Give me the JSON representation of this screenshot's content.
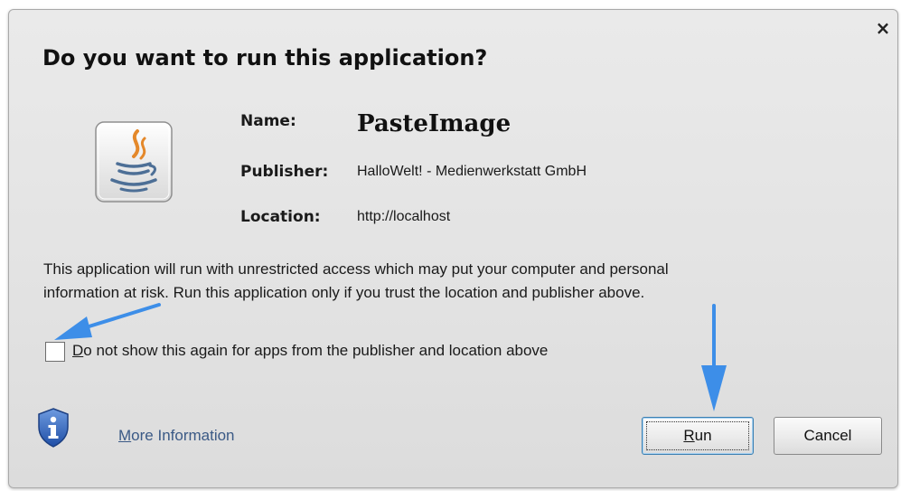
{
  "dialog": {
    "title": "Do you want to run this application?",
    "close_glyph": "×"
  },
  "app_info": {
    "name_label": "Name:",
    "name_value": "PasteImage",
    "publisher_label": "Publisher:",
    "publisher_value": "HalloWelt! - Medienwerkstatt GmbH",
    "location_label": "Location:",
    "location_value": "http://localhost"
  },
  "warning": {
    "line1": "This application will run with unrestricted access which may put your computer and personal",
    "line2": "information at risk. Run this application only if you trust the location and publisher above."
  },
  "checkbox": {
    "label_mnemonic": "D",
    "label_rest": "o not show this again for apps from the publisher and location above",
    "checked": false
  },
  "footer": {
    "more_info_mnemonic": "M",
    "more_info_rest": "ore Information",
    "run_mnemonic": "R",
    "run_rest": "un",
    "cancel_label": "Cancel"
  },
  "icons": {
    "app": "java-coffee-cup-icon",
    "info": "shield-info-icon",
    "close": "close-icon"
  },
  "colors": {
    "dialog_bg": "#e6e6e6",
    "link": "#3b5a86",
    "annotation_arrow": "#3d8ee8",
    "java_red": "#e4882a",
    "shield_blue": "#2d5fb6"
  }
}
